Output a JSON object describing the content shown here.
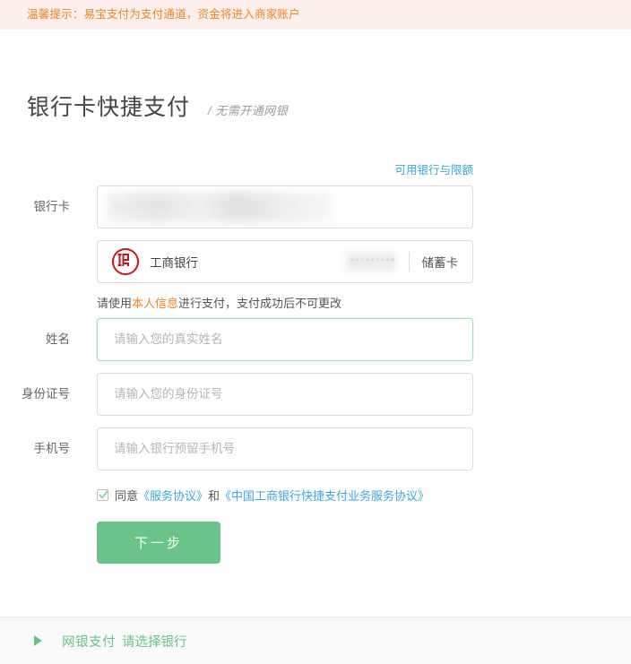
{
  "notice": {
    "text": "温馨提示：易宝支付为支付通道，资金将进入商家账户",
    "color": "#f08326",
    "background": "#fdf0ec"
  },
  "header": {
    "title": "银行卡快捷支付",
    "subtitle": "/ 无需开通网银"
  },
  "links": {
    "available_banks": "可用银行与限额"
  },
  "form": {
    "card_row": {
      "label": "银行卡",
      "value_masked": "6222 0*** **** **** ***",
      "redacted": true
    },
    "bank_row": {
      "logo_name": "icbc-logo",
      "bank_name": "工商银行",
      "card_mask": "*********",
      "card_type": "储蓄卡"
    },
    "hint": {
      "prefix": "请使用",
      "emphasis": "本人信息",
      "suffix": "进行支付，支付成功后不可更改",
      "emphasis_color": "#f08326"
    },
    "name_row": {
      "label": "姓名",
      "placeholder": "请输入您的真实姓名",
      "value": "",
      "focused": true
    },
    "id_row": {
      "label": "身份证号",
      "placeholder": "请输入您的身份证号",
      "value": ""
    },
    "phone_row": {
      "label": "手机号",
      "placeholder": "请输入银行预留手机号",
      "value": ""
    },
    "agreement": {
      "checked": true,
      "prefix": "同意",
      "link1": "《服务协议》",
      "middle": "和",
      "link2": "《中国工商银行快捷支付业务服务协议》"
    },
    "submit": {
      "label": "下一步",
      "color": "#6ac48a"
    }
  },
  "bottom": {
    "arrow": "triangle-right-icon",
    "label": "网银支付",
    "sub_label": "请选择银行",
    "color": "#6ac48a"
  }
}
